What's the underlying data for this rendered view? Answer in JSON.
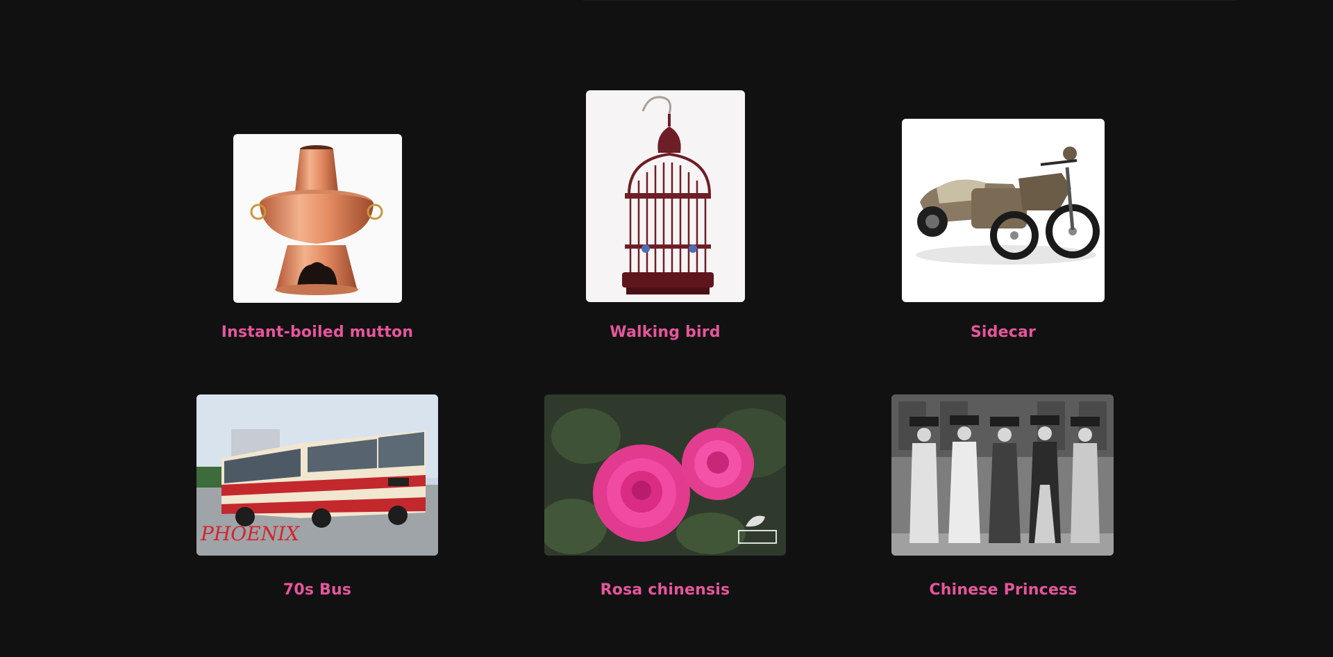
{
  "gallery": {
    "items": [
      {
        "label": "Instant-boiled mutton",
        "image": "copper-hotpot-image"
      },
      {
        "label": "Walking bird",
        "image": "birdcage-image"
      },
      {
        "label": "Sidecar",
        "image": "sidecar-motorcycle-image"
      },
      {
        "label": "70s Bus",
        "image": "vintage-bus-image",
        "overlay_text": "PHOENIX"
      },
      {
        "label": "Rosa chinensis",
        "image": "pink-roses-image"
      },
      {
        "label": "Chinese Princess",
        "image": "qing-princesses-photo"
      }
    ]
  },
  "colors": {
    "background": "#121112",
    "caption": "#e5569c"
  }
}
